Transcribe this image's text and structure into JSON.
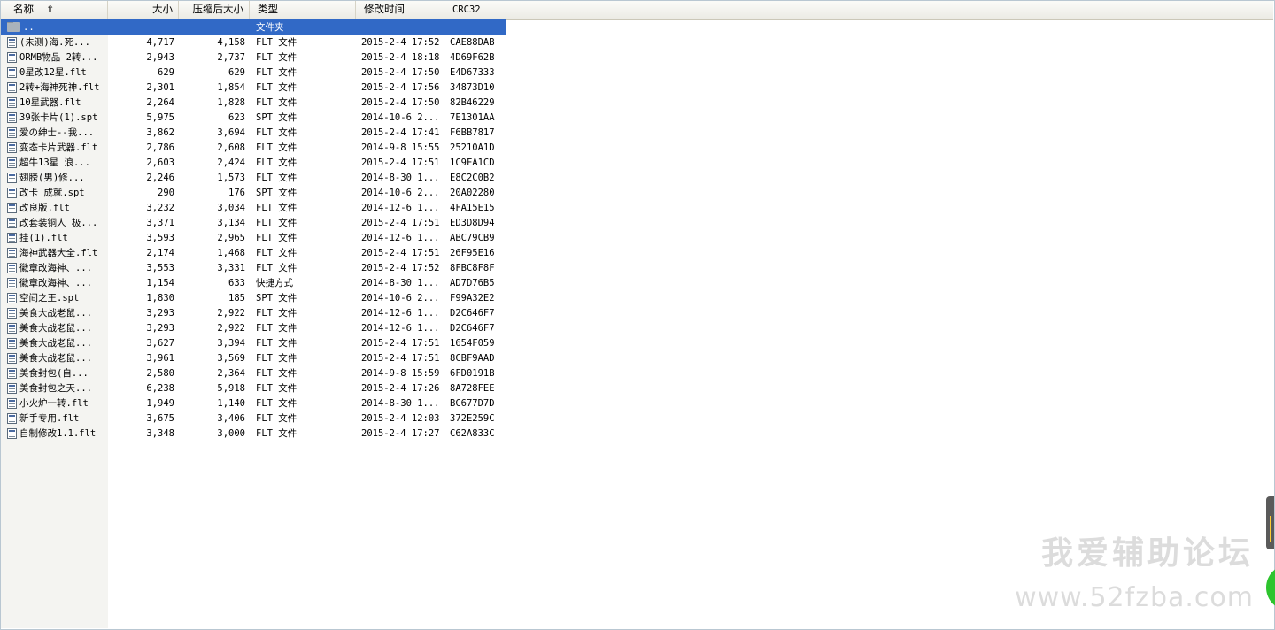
{
  "columns": {
    "name": "名称",
    "size": "大小",
    "packed": "压缩后大小",
    "type": "类型",
    "modified": "修改时间",
    "crc": "CRC32"
  },
  "parent_row": {
    "name": "..",
    "type": "文件夹"
  },
  "files": [
    {
      "name": "(未测)海.死...",
      "size": "4,717",
      "packed": "4,158",
      "type": "FLT 文件",
      "modified": "2015-2-4 17:52",
      "crc": "CAE88DAB"
    },
    {
      "name": "ORMB物品 2转...",
      "size": "2,943",
      "packed": "2,737",
      "type": "FLT 文件",
      "modified": "2015-2-4 18:18",
      "crc": "4D69F62B"
    },
    {
      "name": "0星改12星.flt",
      "size": "629",
      "packed": "629",
      "type": "FLT 文件",
      "modified": "2015-2-4 17:50",
      "crc": "E4D67333"
    },
    {
      "name": "2转+海神死神.flt",
      "size": "2,301",
      "packed": "1,854",
      "type": "FLT 文件",
      "modified": "2015-2-4 17:56",
      "crc": "34873D10"
    },
    {
      "name": "10星武器.flt",
      "size": "2,264",
      "packed": "1,828",
      "type": "FLT 文件",
      "modified": "2015-2-4 17:50",
      "crc": "82B46229"
    },
    {
      "name": "39张卡片(1).spt",
      "size": "5,975",
      "packed": "623",
      "type": "SPT 文件",
      "modified": "2014-10-6 2...",
      "crc": "7E1301AA"
    },
    {
      "name": "爱の绅士--我...",
      "size": "3,862",
      "packed": "3,694",
      "type": "FLT 文件",
      "modified": "2015-2-4 17:41",
      "crc": "F6BB7817"
    },
    {
      "name": "变态卡片武器.flt",
      "size": "2,786",
      "packed": "2,608",
      "type": "FLT 文件",
      "modified": "2014-9-8 15:55",
      "crc": "25210A1D"
    },
    {
      "name": "超牛13星  浪...",
      "size": "2,603",
      "packed": "2,424",
      "type": "FLT 文件",
      "modified": "2015-2-4 17:51",
      "crc": "1C9FA1CD"
    },
    {
      "name": "翅膀(男)修...",
      "size": "2,246",
      "packed": "1,573",
      "type": "FLT 文件",
      "modified": "2014-8-30 1...",
      "crc": "E8C2C0B2"
    },
    {
      "name": "改卡 成就.spt",
      "size": "290",
      "packed": "176",
      "type": "SPT 文件",
      "modified": "2014-10-6 2...",
      "crc": "20A02280"
    },
    {
      "name": "改良版.flt",
      "size": "3,232",
      "packed": "3,034",
      "type": "FLT 文件",
      "modified": "2014-12-6 1...",
      "crc": "4FA15E15"
    },
    {
      "name": "改套装铜人 极...",
      "size": "3,371",
      "packed": "3,134",
      "type": "FLT 文件",
      "modified": "2015-2-4 17:51",
      "crc": "ED3D8D94"
    },
    {
      "name": "挂(1).flt",
      "size": "3,593",
      "packed": "2,965",
      "type": "FLT 文件",
      "modified": "2014-12-6 1...",
      "crc": "ABC79CB9"
    },
    {
      "name": "海神武器大全.flt",
      "size": "2,174",
      "packed": "1,468",
      "type": "FLT 文件",
      "modified": "2015-2-4 17:51",
      "crc": "26F95E16"
    },
    {
      "name": "徽章改海神、...",
      "size": "3,553",
      "packed": "3,331",
      "type": "FLT 文件",
      "modified": "2015-2-4 17:52",
      "crc": "8FBC8F8F"
    },
    {
      "name": "徽章改海神、...",
      "size": "1,154",
      "packed": "633",
      "type": "快捷方式",
      "modified": "2014-8-30 1...",
      "crc": "AD7D76B5"
    },
    {
      "name": "空间之王.spt",
      "size": "1,830",
      "packed": "185",
      "type": "SPT 文件",
      "modified": "2014-10-6 2...",
      "crc": "F99A32E2"
    },
    {
      "name": "美食大战老鼠...",
      "size": "3,293",
      "packed": "2,922",
      "type": "FLT 文件",
      "modified": "2014-12-6 1...",
      "crc": "D2C646F7"
    },
    {
      "name": "美食大战老鼠...",
      "size": "3,293",
      "packed": "2,922",
      "type": "FLT 文件",
      "modified": "2014-12-6 1...",
      "crc": "D2C646F7"
    },
    {
      "name": "美食大战老鼠...",
      "size": "3,627",
      "packed": "3,394",
      "type": "FLT 文件",
      "modified": "2015-2-4 17:51",
      "crc": "1654F059"
    },
    {
      "name": "美食大战老鼠...",
      "size": "3,961",
      "packed": "3,569",
      "type": "FLT 文件",
      "modified": "2015-2-4 17:51",
      "crc": "8CBF9AAD"
    },
    {
      "name": "美食封包(自...",
      "size": "2,580",
      "packed": "2,364",
      "type": "FLT 文件",
      "modified": "2014-9-8 15:59",
      "crc": "6FD0191B"
    },
    {
      "name": "美食封包之天...",
      "size": "6,238",
      "packed": "5,918",
      "type": "FLT 文件",
      "modified": "2015-2-4 17:26",
      "crc": "8A728FEE"
    },
    {
      "name": "小火炉一转.flt",
      "size": "1,949",
      "packed": "1,140",
      "type": "FLT 文件",
      "modified": "2014-8-30 1...",
      "crc": "BC677D7D"
    },
    {
      "name": "新手专用.flt",
      "size": "3,675",
      "packed": "3,406",
      "type": "FLT 文件",
      "modified": "2015-2-4 12:03",
      "crc": "372E259C"
    },
    {
      "name": "自制修改1.1.flt",
      "size": "3,348",
      "packed": "3,000",
      "type": "FLT 文件",
      "modified": "2015-2-4 17:27",
      "crc": "C62A833C"
    }
  ],
  "watermark": {
    "title": "我爱辅助论坛",
    "url": "www.52fzba.com"
  },
  "colors": {
    "selection": "#3169c6",
    "header": "#ebeae4",
    "watermark": "#dcdcdc"
  }
}
